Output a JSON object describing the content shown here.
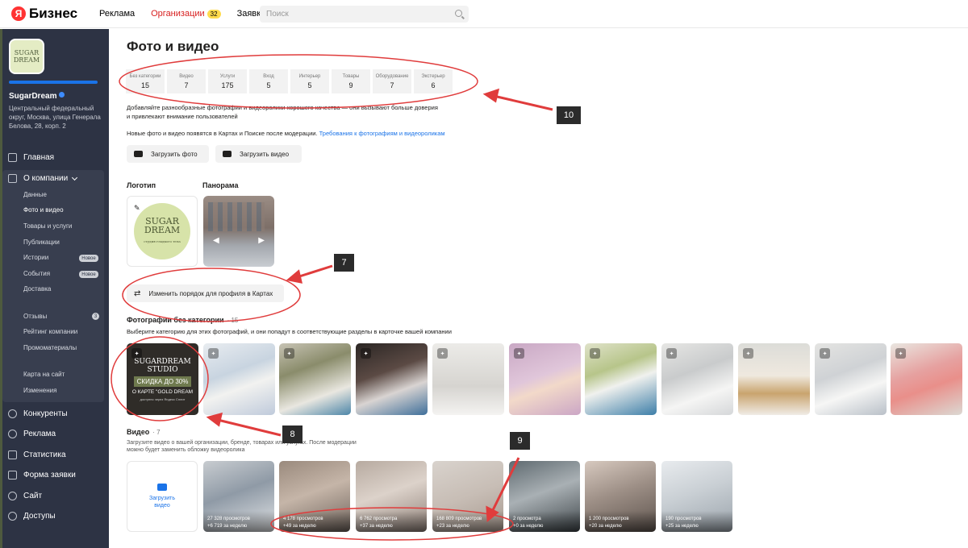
{
  "topbar": {
    "logo_ya": "Я",
    "logo_text": "Бизнес",
    "nav": [
      {
        "label": "Реклама"
      },
      {
        "label": "Организации",
        "badge": "32",
        "active": true
      },
      {
        "label": "Заявки"
      }
    ],
    "search_placeholder": "Поиск"
  },
  "sidebar": {
    "avatar_line1": "SUGAR",
    "avatar_line2": "DREAM",
    "business_name": "SugarDream",
    "address": "Центральный федеральный округ, Москва, улица Генерала Белова, 28, корп. 2",
    "main_nav": {
      "home": "Главная",
      "company": "О компании",
      "competitors": "Конкуренты",
      "ads": "Реклама",
      "stats": "Статистика",
      "form": "Форма заявки",
      "site": "Сайт",
      "access": "Доступы"
    },
    "sub_nav": {
      "data": "Данные",
      "photos": "Фото и видео",
      "goods": "Товары и услуги",
      "publications": "Публикации",
      "stories": "Истории",
      "stories_badge": "Новое",
      "events": "События",
      "events_badge": "Новое",
      "delivery": "Доставка",
      "reviews": "Отзывы",
      "reviews_count": "3",
      "rating": "Рейтинг компании",
      "promo": "Промоматериалы",
      "map_card": "Карта на сайт",
      "changes": "Изменения"
    }
  },
  "main": {
    "title": "Фото и видео",
    "stats": [
      {
        "label": "Без категории",
        "value": "15"
      },
      {
        "label": "Видео",
        "value": "7"
      },
      {
        "label": "Услуги",
        "value": "175"
      },
      {
        "label": "Вход",
        "value": "5"
      },
      {
        "label": "Интерьер",
        "value": "5"
      },
      {
        "label": "Товары",
        "value": "9"
      },
      {
        "label": "Оборудование",
        "value": "7"
      },
      {
        "label": "Экстерьер",
        "value": "6"
      }
    ],
    "desc1_line1": "Добавляйте разнообразные фотографии и видеоролики хорошего качества — они вызывают больше доверия",
    "desc1_line2": "и привлекают внимание пользователей",
    "desc2": "Новые фото и видео появятся в Картах и Поиске после модерации.",
    "desc2_link": "Требования к фотографиям и видеороликам",
    "upload_photo": "Загрузить фото",
    "upload_video": "Загрузить видео",
    "logo_label": "Логотип",
    "panorama_label": "Панорама",
    "logo_line1": "SUGAR",
    "logo_line2": "DREAM",
    "logo_small": "студия гладкого тела",
    "reorder_label": "Изменить порядок для профиля в Картах",
    "uncat_title": "Фотографии без категории",
    "uncat_count": "· 15",
    "uncat_desc": "Выберите категорию для этих фотографий, и они попадут в соответствующие разделы в карточке вашей компании",
    "promo": {
      "line1": "SUGARDREAM",
      "line2": "STUDIO",
      "bar": "СКИДКА ДО 30%",
      "sub": "О КАРТЕ \"GOLD DREAM",
      "foot": "доступно через Яндекс Сплит"
    },
    "video_title": "Видео",
    "video_count": "· 7",
    "video_desc_line1": "Загрузите видео о вашей организации, бренде, товарах или услугах. После модерации",
    "video_desc_line2": "можно будет заменить обложку видеоролика",
    "video_add": "Загрузить видео",
    "videos": [
      {
        "views": "27 328 просмотров",
        "week": "+6 719 за неделю"
      },
      {
        "views": "4 178 просмотров",
        "week": "+49 за неделю"
      },
      {
        "views": "6 762 просмотра",
        "week": "+37 за неделю"
      },
      {
        "views": "168 809 просмотров",
        "week": "+23 за неделю"
      },
      {
        "views": "2 просмотра",
        "week": "+0 за неделю"
      },
      {
        "views": "1 200 просмотров",
        "week": "+20 за неделю"
      },
      {
        "views": "190 просмотров",
        "week": "+25 за неделю"
      }
    ]
  },
  "annotations": {
    "a7": "7",
    "a8": "8",
    "a9": "9",
    "a10": "10"
  },
  "colors": {
    "accent_red": "#d71e1e",
    "annotation_red": "#e03c3c",
    "link_blue": "#1a73e8",
    "sidebar_bg": "#2d3344"
  }
}
